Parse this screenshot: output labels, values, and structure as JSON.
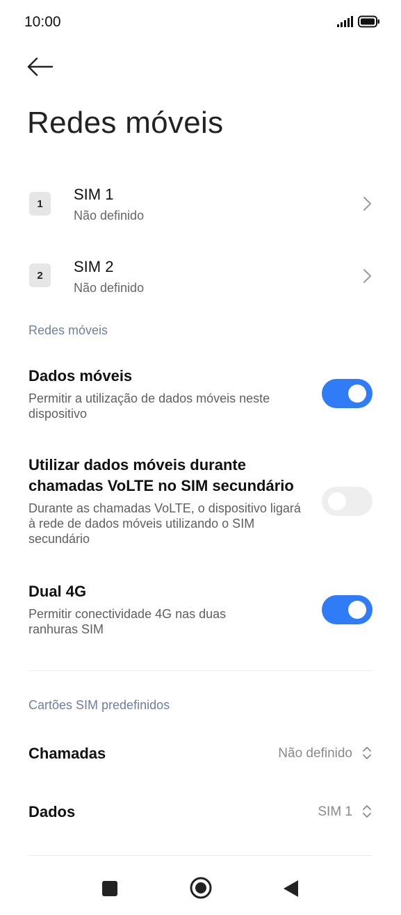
{
  "status_bar": {
    "time": "10:00",
    "icons": [
      "signal-icon",
      "battery-icon"
    ]
  },
  "header": {
    "title": "Redes móveis",
    "back_icon": "arrow-left-icon"
  },
  "sims": [
    {
      "badge": "1",
      "title": "SIM 1",
      "subtitle": "Não definido"
    },
    {
      "badge": "2",
      "title": "SIM 2",
      "subtitle": "Não definido"
    }
  ],
  "section_networks": "Redes móveis",
  "settings": [
    {
      "title": "Dados móveis",
      "description": "Permitir a utilização de dados móveis neste dispositivo",
      "enabled": true
    },
    {
      "title": "Utilizar dados móveis durante chamadas VoLTE no SIM secundário",
      "description": "Durante as chamadas VoLTE, o dispositivo ligará à rede de dados móveis utilizando o SIM secundário",
      "enabled": false
    },
    {
      "title": "Dual 4G",
      "description": "Permitir conectividade 4G nas duas ranhuras SIM",
      "enabled": true
    }
  ],
  "section_default_sims": "Cartões SIM predefinidos",
  "defaults": [
    {
      "label": "Chamadas",
      "value": "Não definido"
    },
    {
      "label": "Dados",
      "value": "SIM 1"
    }
  ],
  "colors": {
    "accent": "#2f7cf6",
    "section": "#6e7fa3",
    "toggle_off": "#eeeeee"
  },
  "nav_bar": [
    "square-recents-icon",
    "circle-home-icon",
    "triangle-back-icon"
  ]
}
